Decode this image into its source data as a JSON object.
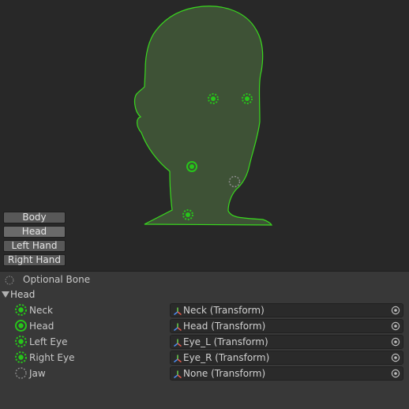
{
  "body_parts": [
    "Body",
    "Head",
    "Left Hand",
    "Right Hand"
  ],
  "active_part": "Head",
  "legend": {
    "optional_label": "Optional Bone"
  },
  "section": {
    "label": "Head",
    "expanded": true
  },
  "bones": [
    {
      "label": "Neck",
      "value": "Neck (Transform)",
      "state": "mapped"
    },
    {
      "label": "Head",
      "value": "Head (Transform)",
      "state": "mapped-required"
    },
    {
      "label": "Left Eye",
      "value": "Eye_L (Transform)",
      "state": "mapped"
    },
    {
      "label": "Right Eye",
      "value": "Eye_R (Transform)",
      "state": "mapped"
    },
    {
      "label": "Jaw",
      "value": "None (Transform)",
      "state": "empty"
    }
  ],
  "colors": {
    "background": "#282828",
    "panel": "#383838",
    "silhouette_fill": "#3e5236",
    "silhouette_stroke": "#39d91e",
    "bone_mapped": "#27c51a",
    "bone_empty": "#8c8c8c"
  },
  "icons": {
    "optional": "dashed-circle-icon",
    "section_toggle": "triangle-down-icon",
    "transform": "transform-axes-icon",
    "object_picker": "target-circle-icon"
  }
}
